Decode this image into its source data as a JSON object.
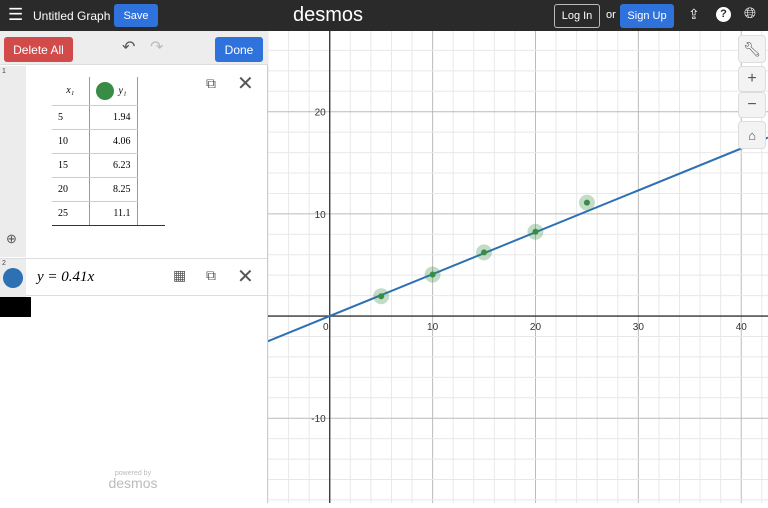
{
  "header": {
    "title": "Untitled Graph",
    "save": "Save",
    "logo": "desmos",
    "login": "Log In",
    "or": "or",
    "signup": "Sign Up"
  },
  "toolbar": {
    "delete_all": "Delete All",
    "done": "Done"
  },
  "expressions": [
    {
      "index": "1",
      "type": "table",
      "col1": "x₁",
      "col2": "y₁",
      "color": "#388c46",
      "rows": [
        [
          "5",
          "1.94"
        ],
        [
          "10",
          "4.06"
        ],
        [
          "15",
          "6.23"
        ],
        [
          "20",
          "8.25"
        ],
        [
          "25",
          "11.1"
        ]
      ]
    },
    {
      "index": "2",
      "type": "expression",
      "latex": "y = 0.41x",
      "color": "#2d70b3"
    }
  ],
  "footer": {
    "powered_by": "powered by",
    "brand": "desmos"
  },
  "chart_data": {
    "type": "scatter",
    "xlim": [
      -6,
      42.6
    ],
    "ylim": [
      -18.3,
      27.9
    ],
    "x_ticks": [
      0,
      10,
      20,
      30,
      40
    ],
    "y_ticks": [
      -10,
      10,
      20
    ],
    "grid": true,
    "points": [
      [
        5,
        1.94
      ],
      [
        10,
        4.06
      ],
      [
        15,
        6.23
      ],
      [
        20,
        8.25
      ],
      [
        25,
        11.1
      ]
    ],
    "line": {
      "slope": 0.41,
      "intercept": 0
    }
  }
}
